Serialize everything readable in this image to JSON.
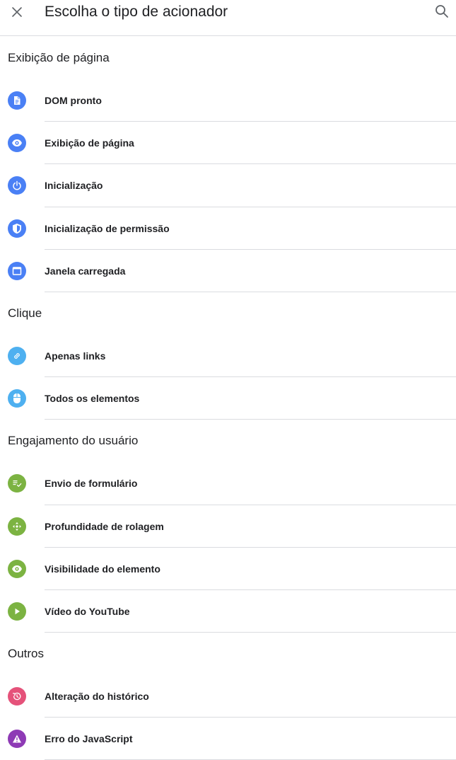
{
  "header": {
    "title": "Escolha o tipo de acionador",
    "close_icon": "close-icon",
    "search_icon": "search-icon"
  },
  "sections": [
    {
      "title": "Exibição de página",
      "items": [
        {
          "label": "DOM pronto",
          "icon": "document-icon",
          "color": "#4a80f5"
        },
        {
          "label": "Exibição de página",
          "icon": "eye-icon",
          "color": "#4a80f5"
        },
        {
          "label": "Inicialização",
          "icon": "power-icon",
          "color": "#4a80f5"
        },
        {
          "label": "Inicialização de permissão",
          "icon": "shield-icon",
          "color": "#4a80f5"
        },
        {
          "label": "Janela carregada",
          "icon": "window-icon",
          "color": "#4a80f5"
        }
      ]
    },
    {
      "title": "Clique",
      "items": [
        {
          "label": "Apenas links",
          "icon": "link-icon",
          "color": "#4eb0f0"
        },
        {
          "label": "Todos os elementos",
          "icon": "mouse-icon",
          "color": "#4eb0f0"
        }
      ]
    },
    {
      "title": "Engajamento do usuário",
      "items": [
        {
          "label": "Envio de formulário",
          "icon": "form-submit-icon",
          "color": "#7cb342"
        },
        {
          "label": "Profundidade de rolagem",
          "icon": "scroll-icon",
          "color": "#7cb342"
        },
        {
          "label": "Visibilidade do elemento",
          "icon": "eye-icon",
          "color": "#7cb342"
        },
        {
          "label": "Vídeo do YouTube",
          "icon": "play-icon",
          "color": "#7cb342"
        }
      ]
    },
    {
      "title": "Outros",
      "items": [
        {
          "label": "Alteração do histórico",
          "icon": "history-icon",
          "color": "#e5527a"
        },
        {
          "label": "Erro do JavaScript",
          "icon": "warning-icon",
          "color": "#8e3ab5"
        }
      ]
    }
  ]
}
